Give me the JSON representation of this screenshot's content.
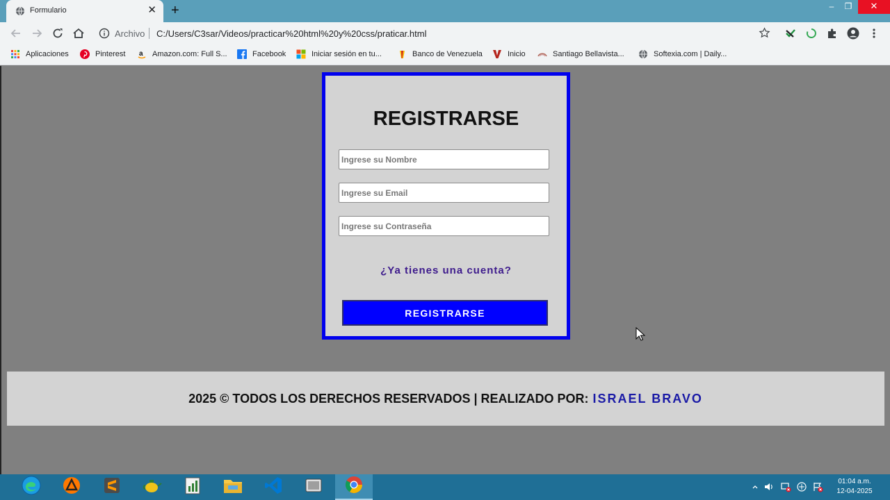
{
  "browser": {
    "tab_title": "Formulario",
    "tab_close": "✕",
    "new_tab": "+",
    "window_controls": {
      "minimize": "–",
      "maximize": "❐",
      "close": "✕"
    },
    "url_scheme": "Archivo",
    "url": "C:/Users/C3sar/Videos/practicar%20html%20y%20css/praticar.html",
    "bookmarks": [
      {
        "label": "Aplicaciones",
        "icon": "apps-grid-icon"
      },
      {
        "label": "Pinterest",
        "icon": "pinterest-icon"
      },
      {
        "label": "Amazon.com: Full S...",
        "icon": "amazon-icon"
      },
      {
        "label": "Facebook",
        "icon": "facebook-icon"
      },
      {
        "label": "Iniciar sesión en tu...",
        "icon": "microsoft-icon"
      },
      {
        "label": "Banco de Venezuela",
        "icon": "bank-icon"
      },
      {
        "label": "Inicio",
        "icon": "v-logo-icon"
      },
      {
        "label": "Santiago Bellavista...",
        "icon": "site-icon"
      },
      {
        "label": "Softexia.com | Daily...",
        "icon": "globe-icon"
      }
    ]
  },
  "form": {
    "title": "REGISTRARSE",
    "name_placeholder": "Ingrese su Nombre",
    "email_placeholder": "Ingrese su Email",
    "password_placeholder": "Ingrese su Contraseña",
    "login_link": "¿Ya tienes una cuenta?",
    "submit_label": "REGISTRARSE"
  },
  "footer": {
    "text": "2025 © TODOS LOS DERECHOS RESERVADOS | REALIZADO POR:",
    "author": "ISRAEL BRAVO"
  },
  "taskbar": {
    "apps": [
      "edge-icon",
      "avast-icon",
      "sublime-text-icon",
      "teapot-app-icon",
      "notepad-chart-icon",
      "file-explorer-icon",
      "vscode-icon",
      "media-app-icon",
      "chrome-icon"
    ],
    "clock_time": "01:04 a.m.",
    "clock_date": "12-04-2025"
  },
  "colors": {
    "card_border": "#0000ee",
    "button": "#0000ff",
    "page_background": "#808080",
    "card_background": "#d3d3d3",
    "author": "#1a1aa6"
  }
}
